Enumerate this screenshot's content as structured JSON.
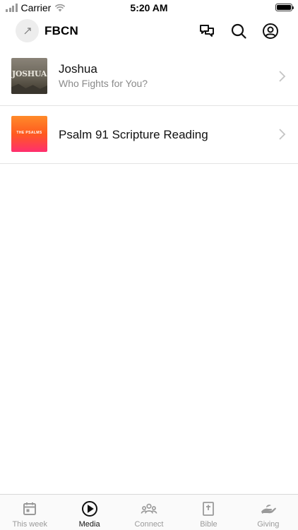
{
  "status_bar": {
    "carrier": "Carrier",
    "time": "5:20 AM"
  },
  "header": {
    "church_name": "FBCN",
    "icons": [
      "chat-icon",
      "search-icon",
      "account-icon"
    ]
  },
  "media": {
    "items": [
      {
        "title": "Joshua",
        "subtitle": "Who Fights for You?",
        "thumb_text": "JOSHUA"
      },
      {
        "title": "Psalm 91 Scripture Reading",
        "thumb_text": "THE PSALMS"
      }
    ]
  },
  "tabs": [
    {
      "label": "This week",
      "icon": "calendar-icon",
      "active": false
    },
    {
      "label": "Media",
      "icon": "play-icon",
      "active": true
    },
    {
      "label": "Connect",
      "icon": "people-icon",
      "active": false
    },
    {
      "label": "Bible",
      "icon": "bible-icon",
      "active": false
    },
    {
      "label": "Giving",
      "icon": "giving-hand-icon",
      "active": false
    }
  ],
  "colors": {
    "active_tab": "#111111",
    "inactive_tab": "#9a9a9a",
    "divider": "#e3e3e3"
  }
}
